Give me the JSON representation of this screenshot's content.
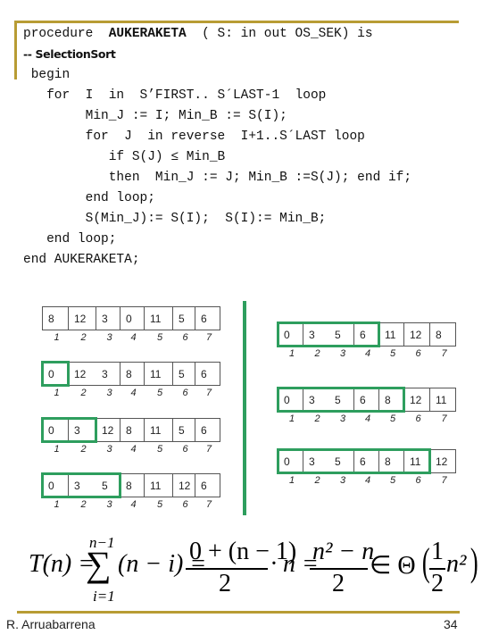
{
  "code": {
    "line1_pre": "procedure  ",
    "line1_name": "AUKERAKETA",
    "line1_post": "  ( S: in out OS_SEK) is",
    "comment": "-- SelectionSort",
    "lines": [
      " begin",
      "   for  I  in  S’FIRST.. S´LAST-1  loop",
      "        Min_J := I; Min_B := S(I);",
      "        for  J  in reverse  I+1..S´LAST loop",
      "           if S(J) ≤ Min_B",
      "           then  Min_J := J; Min_B :=S(J); end if;",
      "        end loop;",
      "        S(Min_J):= S(I);  S(I):= Min_B;",
      "   end loop;",
      "end AUKERAKETA;"
    ]
  },
  "arrays": {
    "indices": [
      "1",
      "2",
      "3",
      "4",
      "5",
      "6",
      "7"
    ],
    "left": [
      {
        "values": [
          "8",
          "12",
          "3",
          "0",
          "11",
          "5",
          "6"
        ],
        "sorted_count": 0
      },
      {
        "values": [
          "0",
          "12",
          "3",
          "8",
          "11",
          "5",
          "6"
        ],
        "sorted_count": 1
      },
      {
        "values": [
          "0",
          "3",
          "12",
          "8",
          "11",
          "5",
          "6"
        ],
        "sorted_count": 2
      },
      {
        "values": [
          "0",
          "3",
          "5",
          "8",
          "11",
          "12",
          "6"
        ],
        "sorted_count": 3
      }
    ],
    "right": [
      {
        "values": [
          "0",
          "3",
          "5",
          "6",
          "11",
          "12",
          "8"
        ],
        "sorted_count": 4
      },
      {
        "values": [
          "0",
          "3",
          "5",
          "6",
          "8",
          "12",
          "11"
        ],
        "sorted_count": 5
      },
      {
        "values": [
          "0",
          "3",
          "5",
          "6",
          "8",
          "11",
          "12"
        ],
        "sorted_count": 6
      }
    ]
  },
  "formula": {
    "lhs": "T(n) =",
    "sum_top": "n−1",
    "sum_bottom": "i=1",
    "sigma": "∑",
    "term": "(n − i) =",
    "frac1_num": "0 + (n − 1)",
    "frac1_den": "2",
    "mult": "· n =",
    "frac2_num": "n² − n",
    "frac2_den": "2",
    "theta": "∈ Θ",
    "paren_open": "(",
    "frac3_num": "1",
    "frac3_den": "2",
    "theta_arg": "n²",
    "paren_close": ")"
  },
  "footer": {
    "author": "R. Arruabarrena",
    "page": "34"
  }
}
